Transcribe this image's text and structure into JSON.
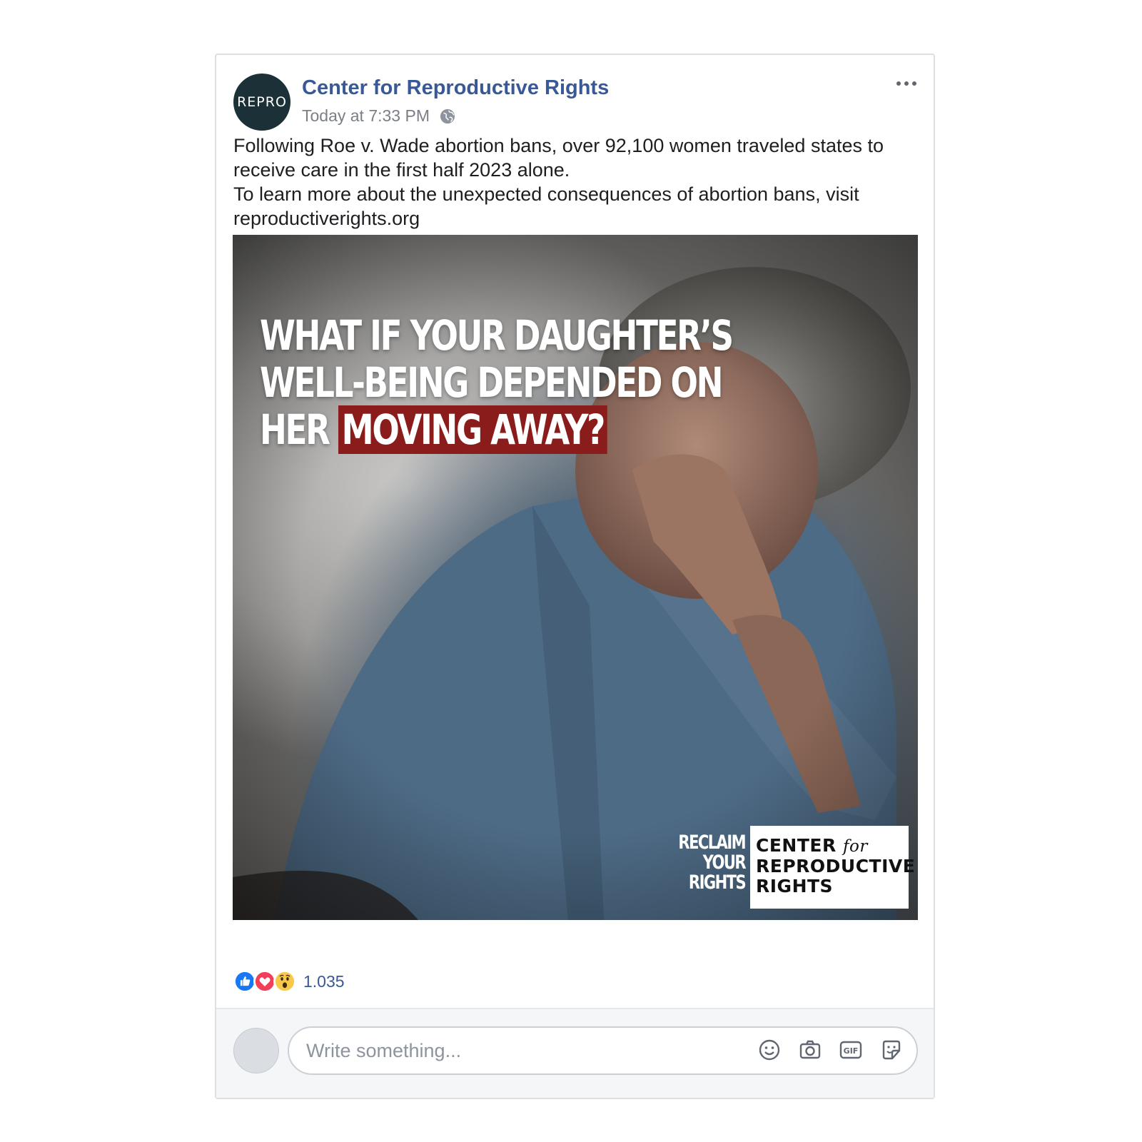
{
  "post": {
    "avatar_text": "REPRO",
    "page_name": "Center for Reproductive Rights",
    "timestamp": "Today at 7:33 PM",
    "privacy_icon": "globe-icon",
    "more_icon": "more-options-icon",
    "text_line1": "Following Roe v. Wade abortion bans, over 92,100 women traveled states to receive care in the first half 2023 alone.",
    "text_line2": "To learn more about the unexpected consequences of abortion bans, visit reproductiverights.org"
  },
  "image": {
    "headline_line1": "WHAT IF YOUR DAUGHTER’S",
    "headline_line2": "WELL-BEING DEPENDED ON",
    "headline_line3_pre": "HER",
    "headline_highlight": "MOVING AWAY?",
    "tagline_1": "RECLAIM",
    "tagline_2": "YOUR",
    "tagline_3": "RIGHTS",
    "logo_line1": "CENTER",
    "logo_for": "for",
    "logo_line2": "REPRODUCTIVE",
    "logo_line3": "RIGHTS",
    "highlight_color": "#8b1c1c"
  },
  "reactions": {
    "icons": [
      "like-icon",
      "love-icon",
      "wow-icon"
    ],
    "count": "1.035"
  },
  "comment": {
    "placeholder": "Write something...",
    "icons": [
      "emoji-icon",
      "camera-icon",
      "gif-icon",
      "sticker-icon"
    ]
  },
  "colors": {
    "link_blue": "#385898",
    "avatar_bg": "#1c3037",
    "border": "#dddfe2"
  }
}
